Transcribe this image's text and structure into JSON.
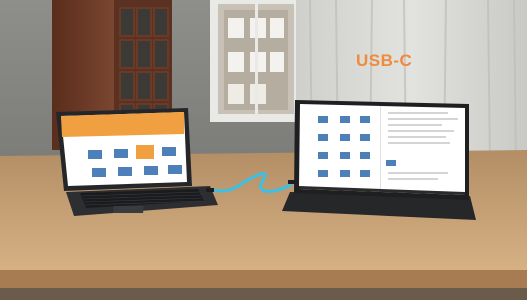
{
  "overlay": {
    "label": "USB-C",
    "label_color": "#f08a3c"
  },
  "colors": {
    "wall": "#8f8f8c",
    "curtain": "#d9d9d6",
    "door": "#6a3a26",
    "table": "#c79e6f",
    "laptop_body": "#2f3134",
    "screen_accent": "#f0a040",
    "cable": "#39c1e8"
  }
}
